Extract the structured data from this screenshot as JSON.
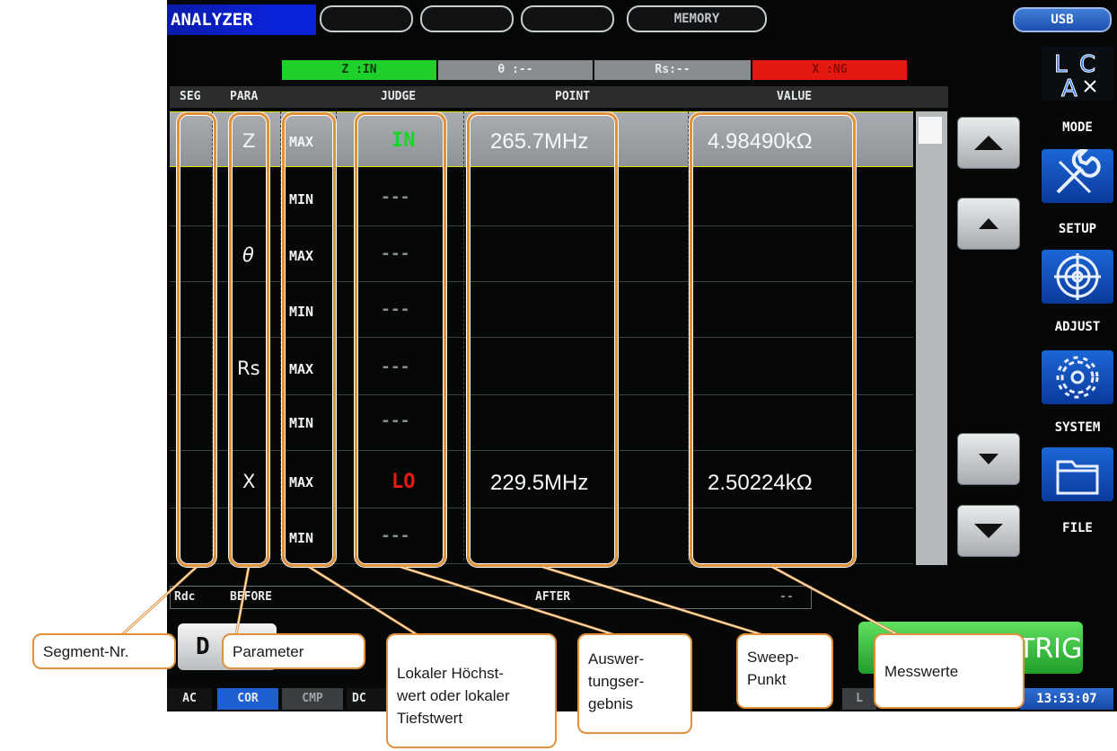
{
  "header": {
    "title": "ANALYZER",
    "tabs": [
      "",
      "",
      "",
      "MEMORY"
    ],
    "usb_label": "USB"
  },
  "status": {
    "z": "Z :IN",
    "theta": "θ :--",
    "rs": "Rs:--",
    "x": "X :NG",
    "colors": {
      "in": "#1fcf2a",
      "ng": "#e41a12",
      "neutral": "#8a8d90"
    }
  },
  "table": {
    "headers": {
      "seg": "SEG",
      "para": "PARA",
      "judge": "JUDGE",
      "point": "POINT",
      "value": "VALUE"
    },
    "rows": [
      {
        "para": "Z",
        "mm": "MAX",
        "judge": "IN",
        "point": "265.7MHz",
        "value": "4.98490kΩ"
      },
      {
        "para": "",
        "mm": "MIN",
        "judge": "---",
        "point": "",
        "value": ""
      },
      {
        "para": "θ",
        "mm": "MAX",
        "judge": "---",
        "point": "",
        "value": ""
      },
      {
        "para": "",
        "mm": "MIN",
        "judge": "---",
        "point": "",
        "value": ""
      },
      {
        "para": "Rs",
        "mm": "MAX",
        "judge": "---",
        "point": "",
        "value": ""
      },
      {
        "para": "",
        "mm": "MIN",
        "judge": "---",
        "point": "",
        "value": ""
      },
      {
        "para": "X",
        "mm": "MAX",
        "judge": "LO",
        "point": "229.5MHz",
        "value": "2.50224kΩ"
      },
      {
        "para": "",
        "mm": "MIN",
        "judge": "---",
        "point": "",
        "value": ""
      }
    ]
  },
  "sidebar": {
    "mode": "MODE",
    "setup": "SETUP",
    "adjust": "ADJUST",
    "system": "SYSTEM",
    "file": "FILE",
    "logo": "LCA"
  },
  "bottom": {
    "rdc": "Rdc",
    "before": "BEFORE",
    "after": "AFTER",
    "dashes": "--",
    "trig": "TRIG",
    "d_btn": "D",
    "strip": [
      "AC",
      "COR",
      "CMP",
      "DC"
    ],
    "lo_fragment": "L",
    "clock": "13:53:07"
  },
  "callouts": {
    "segment": "Segment-Nr.",
    "parameter": "Parameter",
    "local": "Lokaler Höchst-\nwert oder lokaler\nTiefstwert",
    "result": "Auswer-\ntungser-\ngebnis",
    "sweep": "Sweep-\nPunkt",
    "values": "Messwerte"
  }
}
